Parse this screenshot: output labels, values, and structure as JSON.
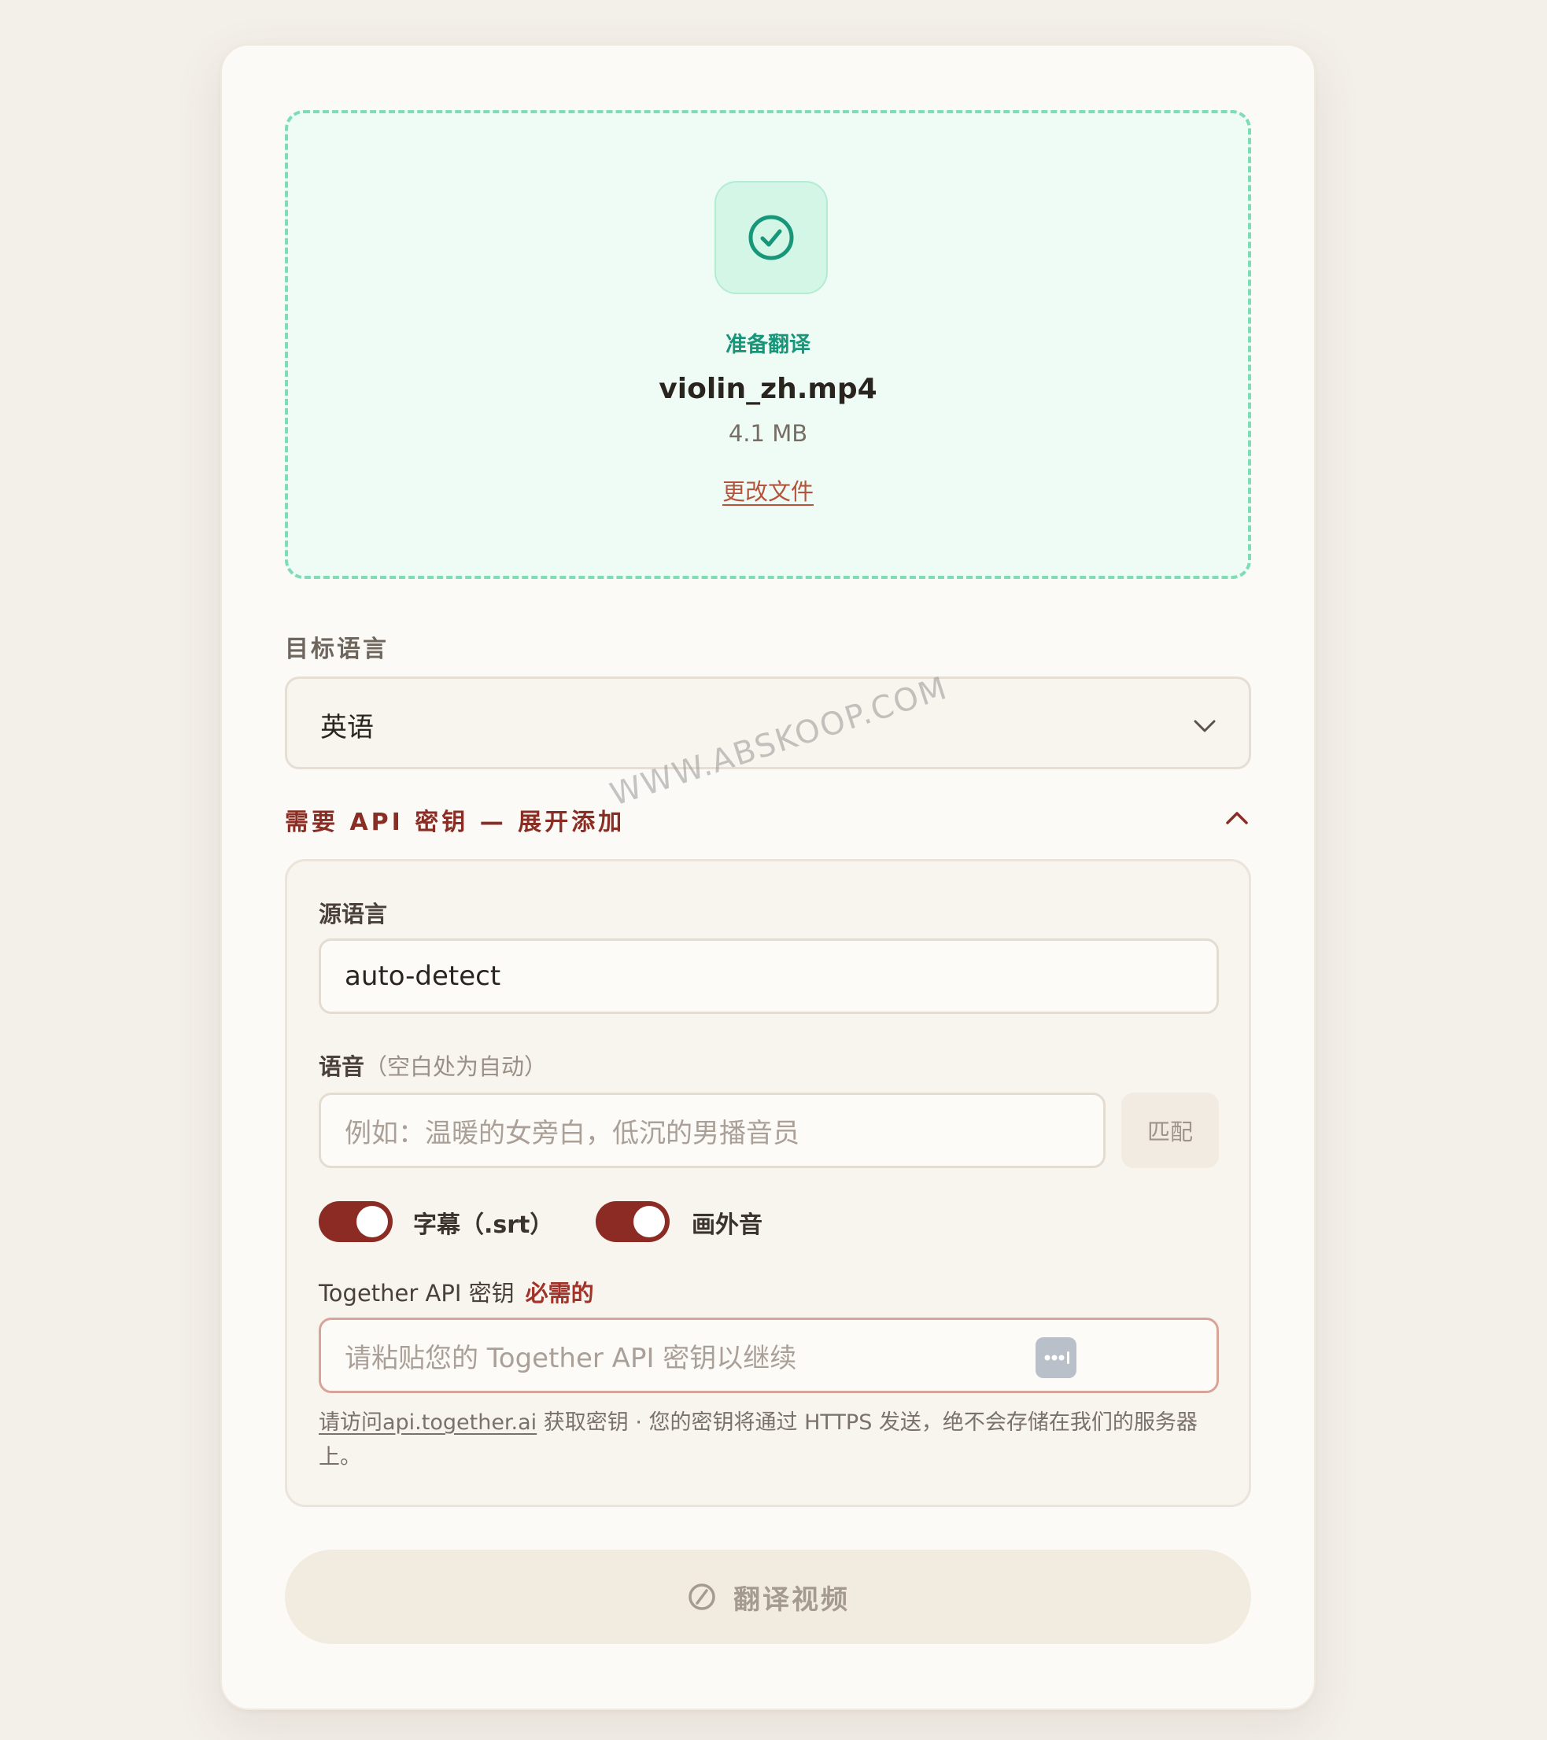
{
  "upload": {
    "status": "准备翻译",
    "file_name": "violin_zh.mp4",
    "file_size": "4.1 MB",
    "change_link": "更改文件"
  },
  "target_language": {
    "label": "目标语言",
    "value": "英语"
  },
  "api_section": {
    "toggle_label": "需要 API 密钥 — 展开添加",
    "expanded": true
  },
  "source_language": {
    "label": "源语言",
    "value": "auto-detect"
  },
  "voice": {
    "label": "语音",
    "hint": "（空白处为自动）",
    "placeholder": "例如：温暖的女旁白，低沉的男播音员",
    "match_button": "匹配"
  },
  "toggles": [
    {
      "label": "字幕（.srt）",
      "on": true
    },
    {
      "label": "画外音",
      "on": true
    }
  ],
  "api_key": {
    "label": "Together API 密钥",
    "required": "必需的",
    "placeholder": "请粘贴您的 Together API 密钥以继续",
    "help_link": "请访问api.together.ai",
    "help_text": " 获取密钥 · 您的密钥将通过 HTTPS 发送，绝不会存储在我们的服务器上。"
  },
  "translate_button": "翻译视频",
  "watermark": "WWW.ABSKOOP.COM",
  "colors": {
    "accent": "#8b2b23",
    "success": "#17967a",
    "dropzone_border": "#7edcb6"
  }
}
